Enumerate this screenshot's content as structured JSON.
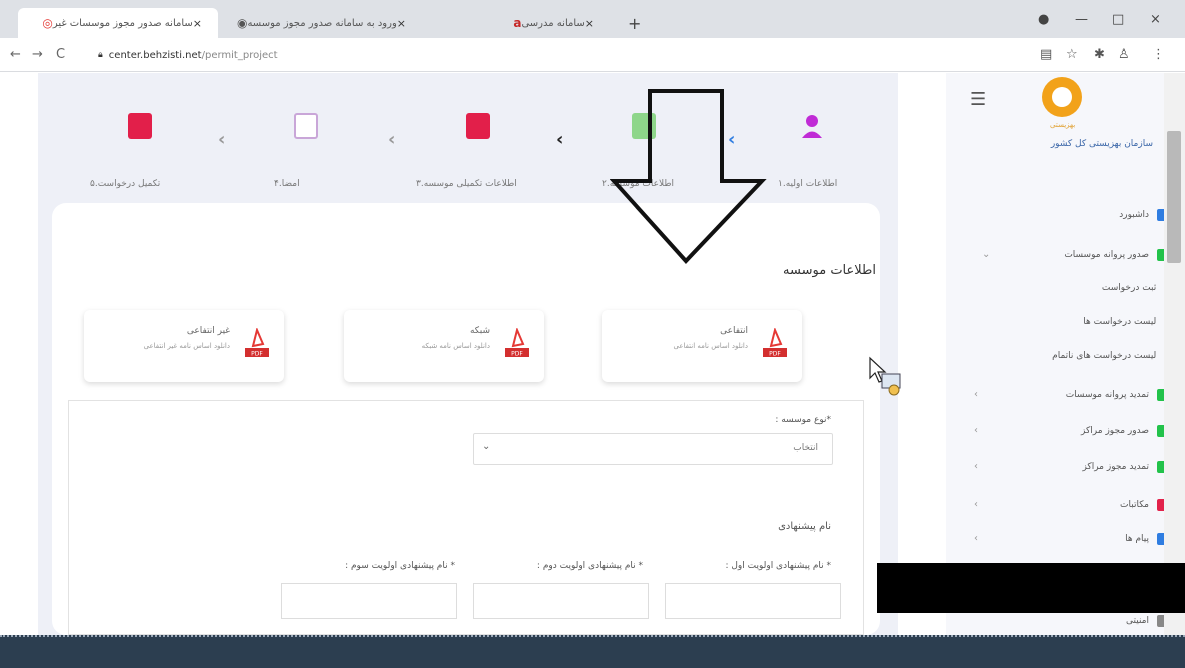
{
  "browser": {
    "tabs": [
      {
        "title": "سامانه صدور مجوز موسسات غیر",
        "close": "×"
      },
      {
        "title": "ورود به سامانه صدور مجوز موسسه",
        "close": "×"
      },
      {
        "title": "سامانه مدرسی",
        "close": "×"
      }
    ],
    "new_tab": "+",
    "url_domain": "center.behzisti.net",
    "url_path": "/permit_project",
    "window_controls": [
      "—",
      "□",
      "×"
    ]
  },
  "stepper": {
    "steps": [
      {
        "label": "۱.اطلاعات اولیه",
        "color": "#c02bd6"
      },
      {
        "label": "۲.اطلاعات موسسه",
        "color": "#8ed68a"
      },
      {
        "label": "۳.اطلاعات تکمیلی موسسه",
        "color": "#e21f4a"
      },
      {
        "label": "۴.امضا",
        "color": "#c9a6d8"
      },
      {
        "label": "۵.تکمیل درخواست",
        "color": "#e21f4a"
      }
    ]
  },
  "section": {
    "title": "اطلاعات موسسه"
  },
  "pdf_cards": [
    {
      "title": "انتفاعی",
      "subtitle": "دانلود اساس نامه انتفاعی"
    },
    {
      "title": "شبکه",
      "subtitle": "دانلود اساس نامه شبکه"
    },
    {
      "title": "غیر انتفاعی",
      "subtitle": "دانلود اساس نامه غیر انتفاعی"
    }
  ],
  "pdf_badge": "PDF",
  "form": {
    "institution_type_label": "*نوع موسسه :",
    "institution_type_value": "انتخاب",
    "suggested_name_title": "نام پیشنهادی",
    "name_priority_1": "* نام پیشنهادی اولویت اول :",
    "name_priority_2": "* نام پیشنهادی اولویت دوم :",
    "name_priority_3": "* نام پیشنهادی اولویت سوم :"
  },
  "sidebar": {
    "org_name": "سازمان بهزیستی کل کشور",
    "logo_caption": "بهزیستی",
    "items": [
      {
        "label": "داشبورد",
        "color": "#2f7de1"
      },
      {
        "label": "صدور پروانه موسسات",
        "color": "#22c24a"
      },
      {
        "label": "ثبت درخواست",
        "sub": true
      },
      {
        "label": "لیست درخواست ها",
        "sub": true
      },
      {
        "label": "لیست درخواست های ناتمام",
        "sub": true
      },
      {
        "label": "تمدید پروانه موسسات",
        "color": "#22c24a"
      },
      {
        "label": "صدور مجوز مراکز",
        "color": "#22c24a"
      },
      {
        "label": "تمدید مجوز مراکز",
        "color": "#22c24a"
      },
      {
        "label": "مکاتبات",
        "color": "#e2224a"
      },
      {
        "label": "پیام ها",
        "color": "#2f7de1"
      },
      {
        "label": "امنیتی",
        "color": "#888888"
      }
    ]
  }
}
